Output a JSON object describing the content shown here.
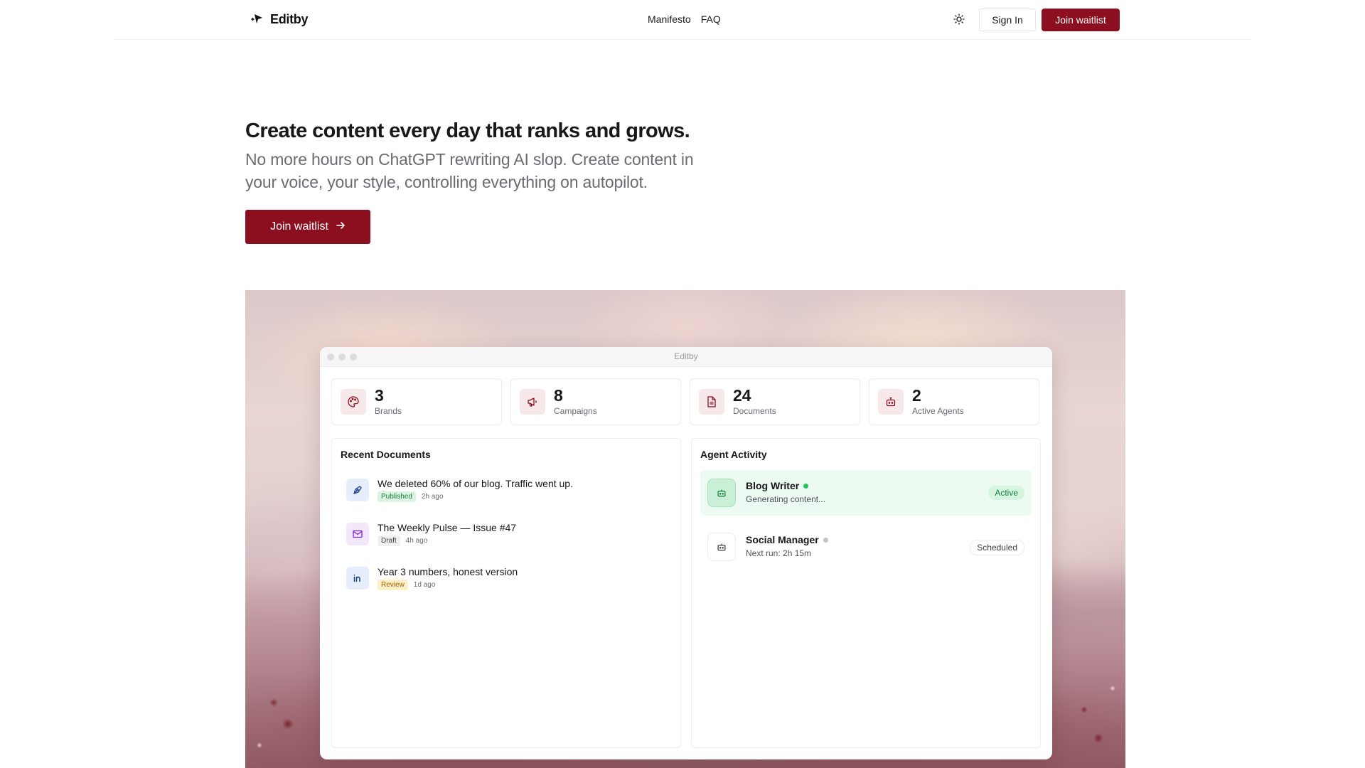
{
  "header": {
    "brand": "Editby",
    "nav": [
      "Manifesto",
      "FAQ"
    ],
    "signin_label": "Sign In",
    "join_label": "Join waitlist"
  },
  "hero": {
    "title": "Create content every day that ranks and grows.",
    "subtitle": "No more hours on ChatGPT rewriting AI slop. Create content in your voice, your style, controlling everything on autopilot.",
    "cta_label": "Join waitlist"
  },
  "app": {
    "window_title": "Editby",
    "stats": [
      {
        "value": "3",
        "label": "Brands",
        "icon": "palette-icon"
      },
      {
        "value": "8",
        "label": "Campaigns",
        "icon": "megaphone-icon"
      },
      {
        "value": "24",
        "label": "Documents",
        "icon": "document-icon"
      },
      {
        "value": "2",
        "label": "Active Agents",
        "icon": "robot-icon"
      }
    ],
    "recent_documents": {
      "title": "Recent Documents",
      "items": [
        {
          "title": "We deleted 60% of our blog. Traffic went up.",
          "status": "Published",
          "time": "2h ago",
          "icon": "pen-icon"
        },
        {
          "title": "The Weekly Pulse — Issue #47",
          "status": "Draft",
          "time": "4h ago",
          "icon": "mail-icon"
        },
        {
          "title": "Year 3 numbers, honest version",
          "status": "Review",
          "time": "1d ago",
          "icon": "linkedin-icon"
        }
      ]
    },
    "agent_activity": {
      "title": "Agent Activity",
      "items": [
        {
          "name": "Blog Writer",
          "detail": "Generating content...",
          "status": "Active"
        },
        {
          "name": "Social Manager",
          "detail": "Next run: 2h 15m",
          "status": "Scheduled"
        }
      ]
    }
  },
  "colors": {
    "accent": "#8b0f1f",
    "published_bg": "#dcf3e3",
    "published_fg": "#15803d",
    "draft_bg": "#f0f0f1",
    "review_bg": "#fdf0c8",
    "review_fg": "#a16207",
    "active_bg": "#ecfaf1"
  }
}
